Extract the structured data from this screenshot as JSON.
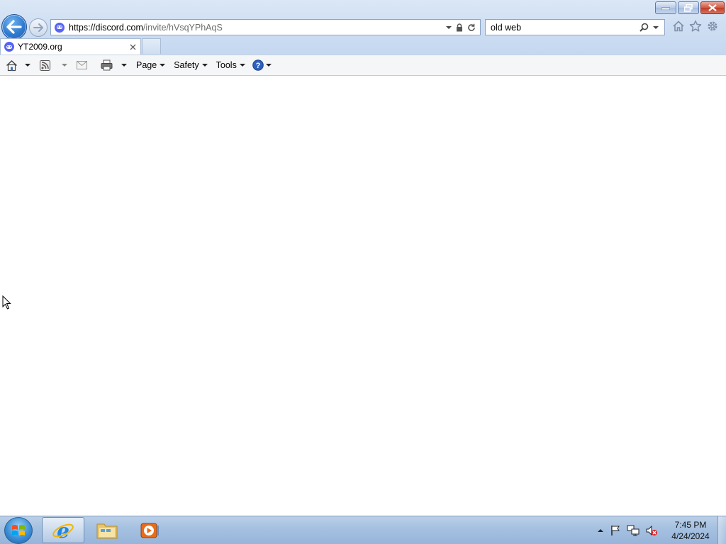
{
  "browser": {
    "address": {
      "protocol_host": "https://discord.com",
      "path": "/invite/hVsqYPhAqS"
    },
    "search": {
      "value": "old web"
    },
    "tab": {
      "title": "YT2009.org"
    },
    "commands": {
      "page": "Page",
      "safety": "Safety",
      "tools": "Tools"
    }
  },
  "taskbar": {
    "clock": {
      "time": "7:45 PM",
      "date": "4/24/2024"
    }
  },
  "colors": {
    "accent": "#2f7bd1",
    "discord": "#5865f2",
    "close": "#c23a22"
  }
}
